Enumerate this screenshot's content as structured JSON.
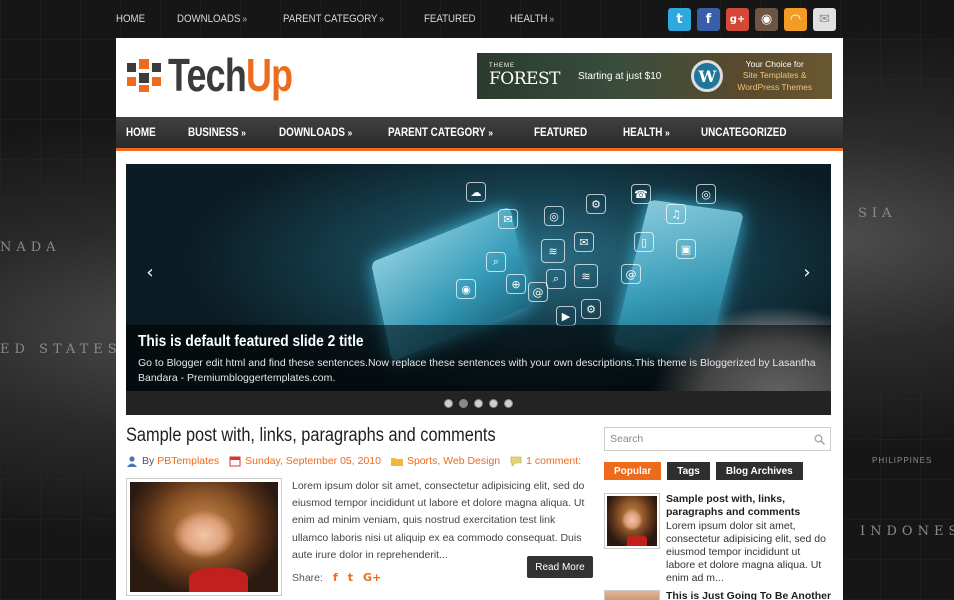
{
  "topbar": {
    "nav": [
      {
        "label": "HOME",
        "arrow": ""
      },
      {
        "label": "DOWNLOADS",
        "arrow": "»"
      },
      {
        "label": "PARENT CATEGORY",
        "arrow": "»"
      },
      {
        "label": "FEATURED",
        "arrow": ""
      },
      {
        "label": "HEALTH",
        "arrow": "»"
      }
    ],
    "social": [
      {
        "name": "twitter-icon",
        "glyph": "t",
        "color": "#2fa8df"
      },
      {
        "name": "facebook-icon",
        "glyph": "f",
        "color": "#3b5ea8"
      },
      {
        "name": "google-plus-icon",
        "glyph": "g+",
        "color": "#d34836"
      },
      {
        "name": "instagram-icon",
        "glyph": "◉",
        "color": "#6d5443"
      },
      {
        "name": "rss-icon",
        "glyph": "◠",
        "color": "#f39c23"
      },
      {
        "name": "email-icon",
        "glyph": "✉",
        "color": "#d9d9d9"
      }
    ]
  },
  "logo": {
    "dark": "Tech",
    "orange": "Up"
  },
  "banner": {
    "brand": "FOREST",
    "brand_small": "THEME",
    "starting": "Starting at just $10",
    "choice_line1": "Your Choice for",
    "choice_line2": "Site Templates &",
    "choice_line3": "WordPress Themes"
  },
  "mainnav": [
    {
      "label": "HOME",
      "arrow": ""
    },
    {
      "label": "BUSINESS",
      "arrow": "»"
    },
    {
      "label": "DOWNLOADS",
      "arrow": "»"
    },
    {
      "label": "PARENT CATEGORY",
      "arrow": "»"
    },
    {
      "label": "FEATURED",
      "arrow": ""
    },
    {
      "label": "HEALTH",
      "arrow": "»"
    },
    {
      "label": "UNCATEGORIZED",
      "arrow": ""
    }
  ],
  "slider": {
    "title": "This is default featured slide 2 title",
    "description": "Go to Blogger edit html and find these sentences.Now replace these sentences with your own descriptions.This theme is Bloggerized by Lasantha Bandara - Premiumbloggertemplates.com.",
    "prev": "‹",
    "next": "›",
    "dots": 5,
    "active_dot": 1
  },
  "post": {
    "title": "Sample post with, links, paragraphs and comments",
    "by": "By",
    "author": "PBTemplates",
    "date": "Sunday, September 05, 2010",
    "categories": "Sports, Web Design",
    "comments": "1 comment:",
    "excerpt": "Lorem ipsum dolor sit amet, consectetur adipisicing elit, sed do eiusmod tempor incididunt ut labore et dolore magna aliqua. Ut enim ad minim veniam, quis nostrud exercitation test link ullamco laboris nisi ut aliquip ex ea commodo consequat. Duis aute irure dolor in reprehenderit...",
    "share": "Share:",
    "read_more": "Read More"
  },
  "sidebar": {
    "search_placeholder": "Search",
    "tabs": [
      "Popular",
      "Tags",
      "Blog Archives"
    ],
    "post1_title": "Sample post with, links, paragraphs and comments",
    "post1_excerpt": "Lorem ipsum dolor sit amet, consectetur adipisicing elit, sed do eiusmod tempor incididunt ut labore et dolore magna aliqua. Ut enim ad m...",
    "post2_title": "This is Just Going To Be Another"
  },
  "map_labels": [
    "NADA",
    "ED STATES",
    "SIA",
    "PHILIPPINES",
    "INDONESI"
  ]
}
